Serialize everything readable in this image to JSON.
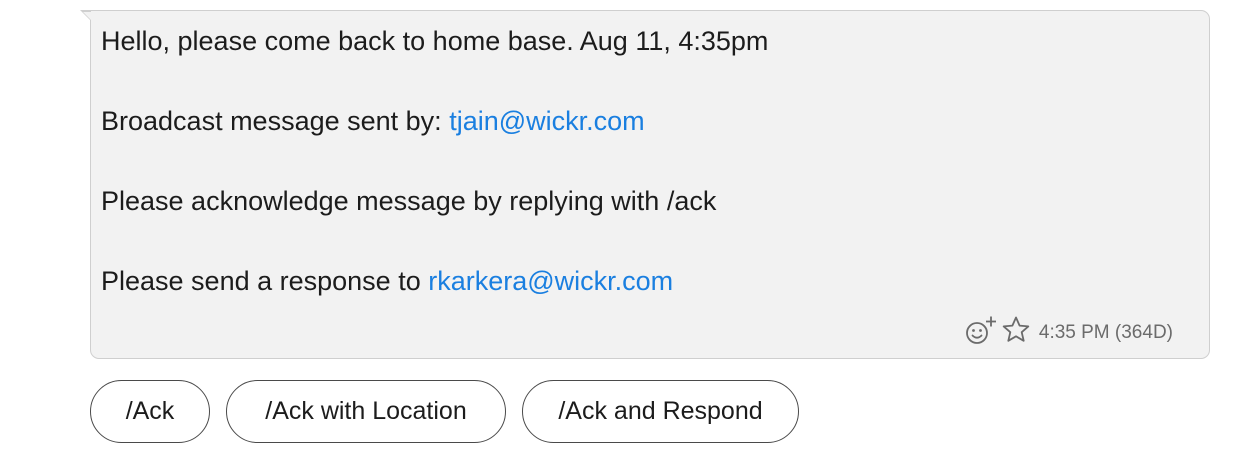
{
  "message": {
    "line1": "Hello, please come back to home base. Aug 11, 4:35pm",
    "line2_prefix": "Broadcast message sent by: ",
    "line2_link": "tjain@wickr.com",
    "line3": "Please acknowledge message by replying with /ack",
    "line4_prefix": "Please send a response to ",
    "line4_link": "rkarkera@wickr.com",
    "timestamp": "4:35 PM (364D)",
    "icons": {
      "reaction": "add-reaction-icon",
      "favorite": "star-icon"
    }
  },
  "actions": [
    {
      "label": "/Ack"
    },
    {
      "label": "/Ack with Location"
    },
    {
      "label": "/Ack and Respond"
    }
  ],
  "colors": {
    "link": "#1a7fe0",
    "bubble_bg": "#f2f2f2",
    "bubble_border": "#cfcfcf",
    "meta_text": "#6b6b6b"
  }
}
